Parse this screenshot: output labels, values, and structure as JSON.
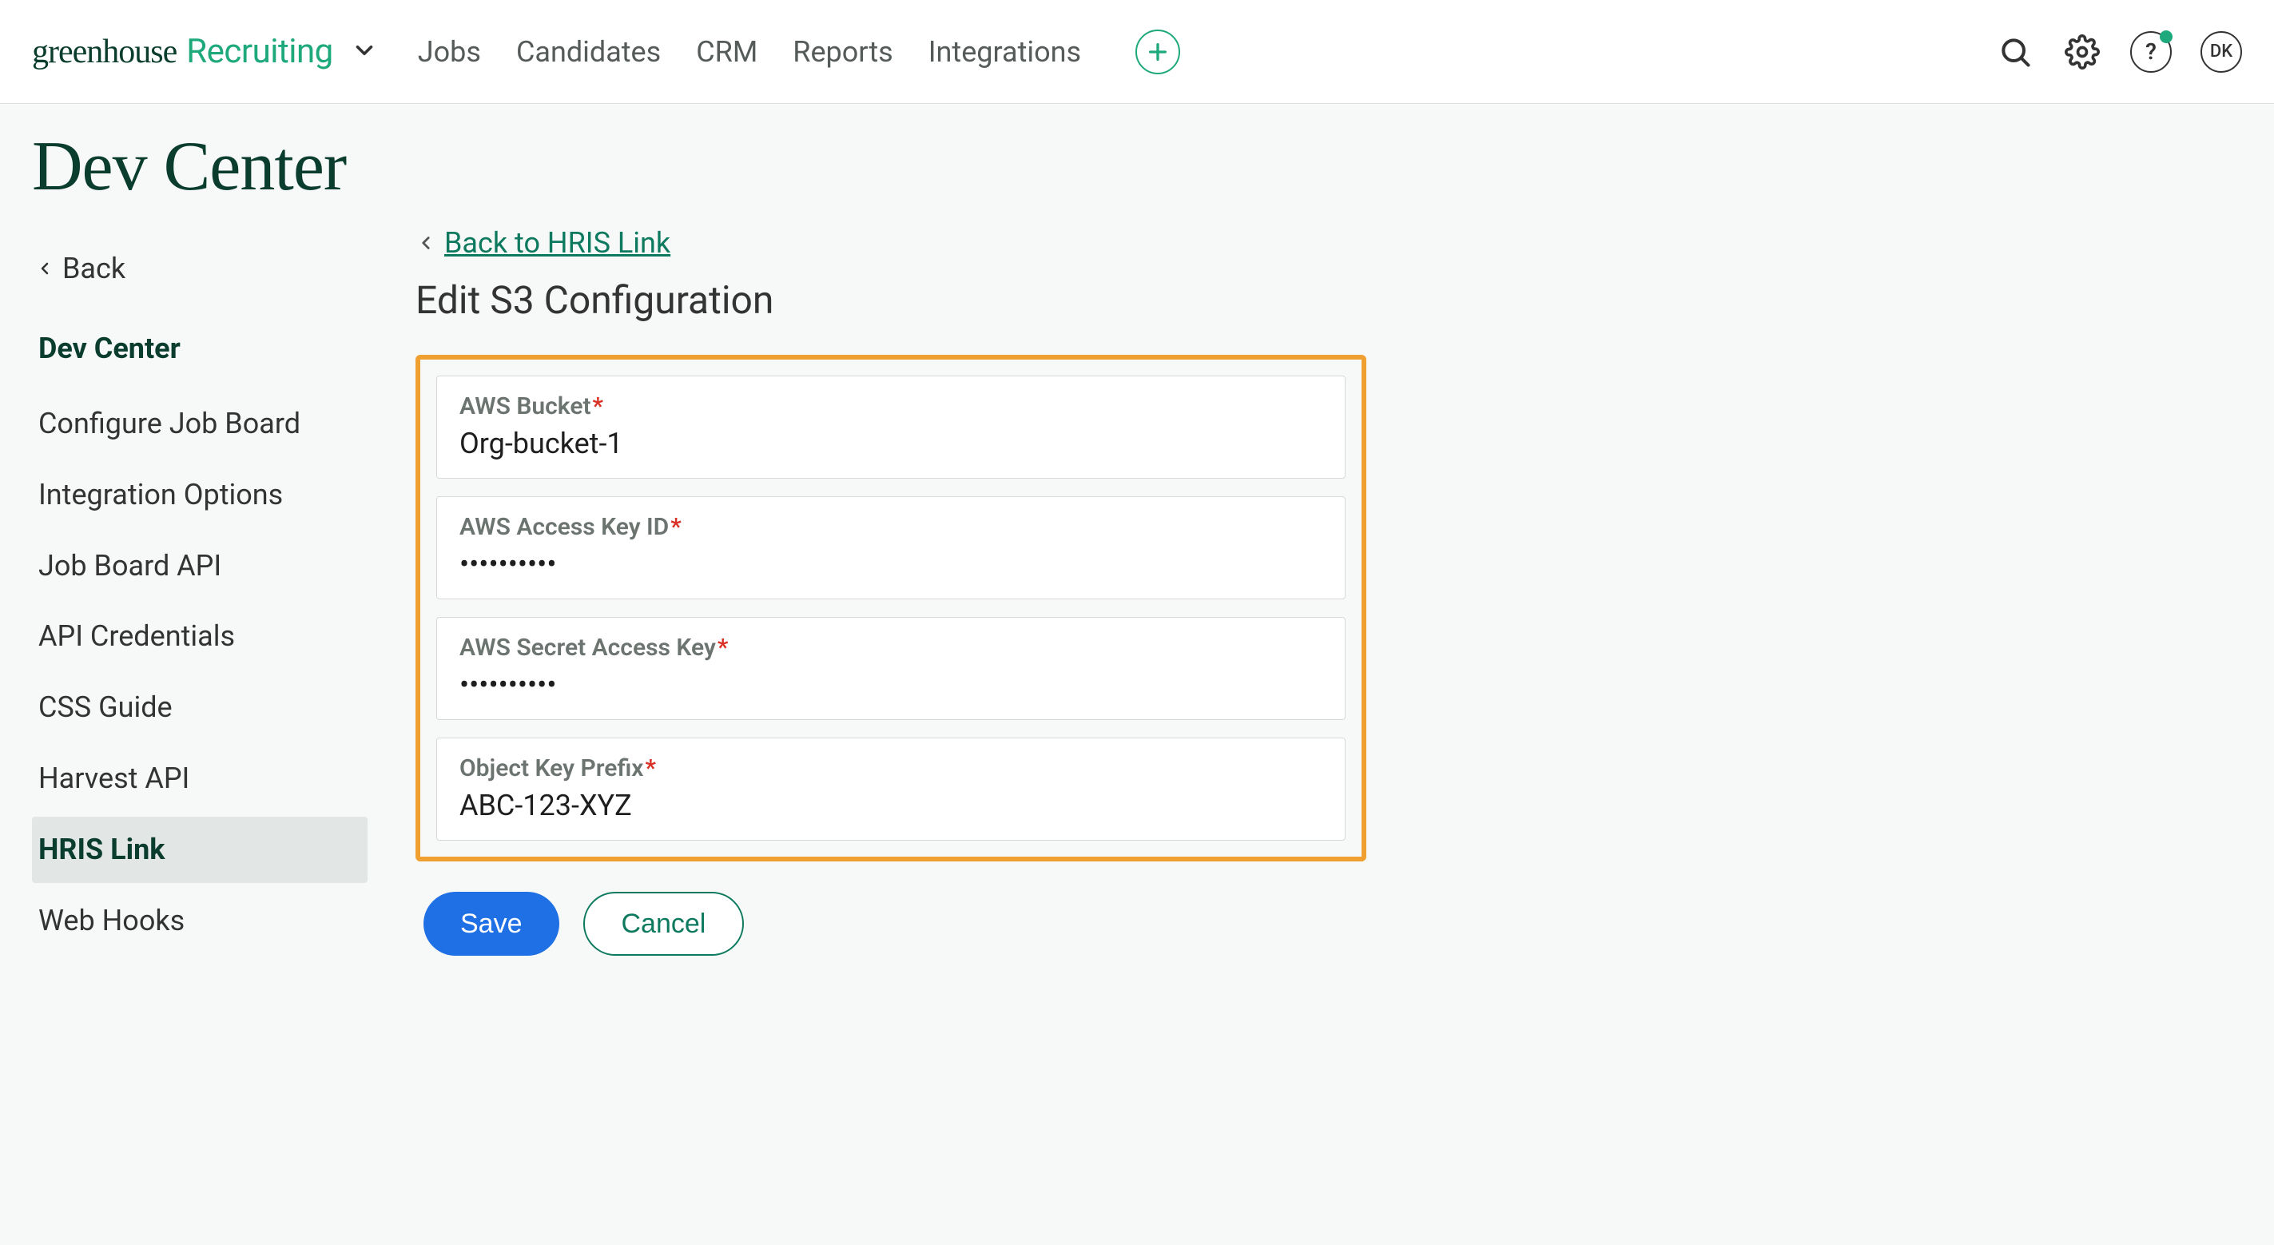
{
  "logo": {
    "part1": "greenhouse",
    "part2": "Recruiting"
  },
  "nav": {
    "jobs": "Jobs",
    "candidates": "Candidates",
    "crm": "CRM",
    "reports": "Reports",
    "integrations": "Integrations"
  },
  "avatar_initials": "DK",
  "help_question": "?",
  "page_title": "Dev Center",
  "sidebar": {
    "back": "Back",
    "heading": "Dev Center",
    "items": [
      "Configure Job Board",
      "Integration Options",
      "Job Board API",
      "API Credentials",
      "CSS Guide",
      "Harvest API",
      "HRIS Link",
      "Web Hooks"
    ],
    "active_index": 6
  },
  "main": {
    "back_link": "Back to HRIS Link",
    "title": "Edit S3 Configuration",
    "fields": {
      "aws_bucket": {
        "label": "AWS Bucket",
        "value": "Org-bucket-1"
      },
      "aws_access_key_id": {
        "label": "AWS Access Key ID",
        "value": "••••••••••"
      },
      "aws_secret_access_key": {
        "label": "AWS Secret Access Key",
        "value": "••••••••••"
      },
      "object_key_prefix": {
        "label": "Object Key Prefix",
        "value": "ABC-123-XYZ"
      }
    },
    "save_label": "Save",
    "cancel_label": "Cancel"
  }
}
